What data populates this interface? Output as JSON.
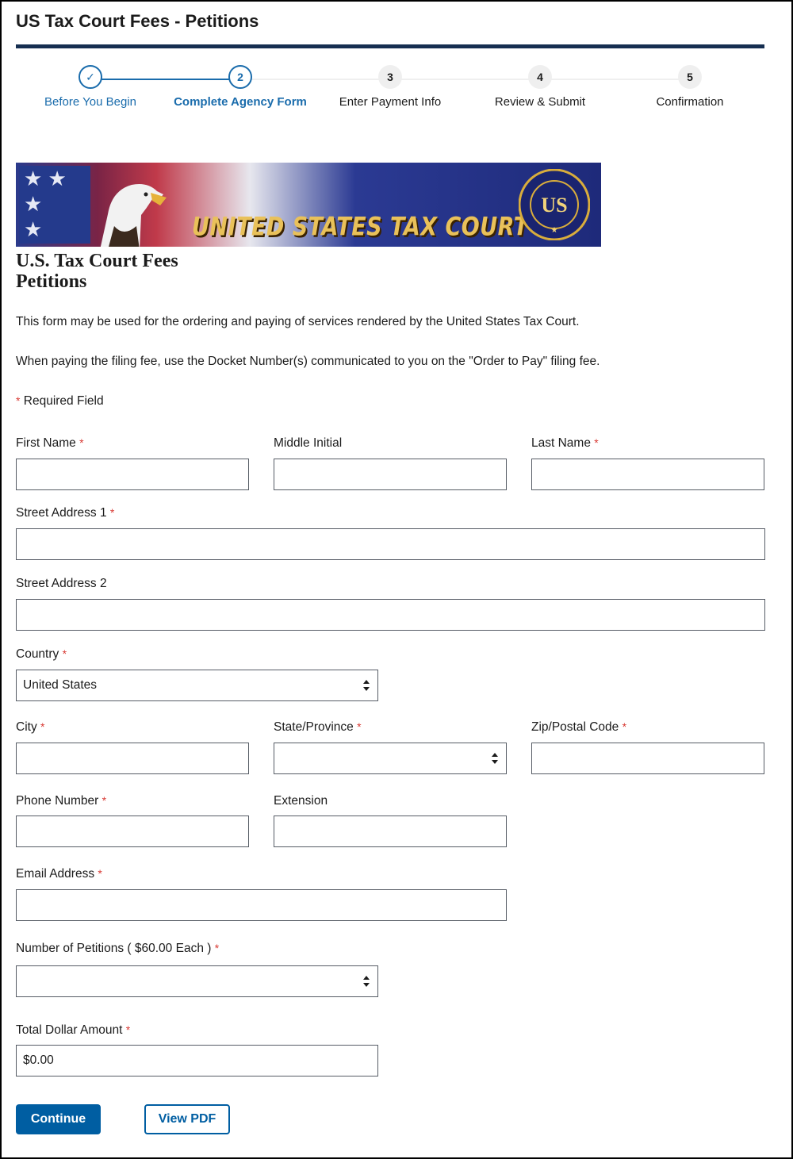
{
  "app": {
    "title": "US Tax Court Fees - Petitions"
  },
  "stepper": {
    "steps": [
      {
        "number": "✓",
        "label": "Before You Begin",
        "state": "done"
      },
      {
        "number": "2",
        "label": "Complete Agency Form",
        "state": "current"
      },
      {
        "number": "3",
        "label": "Enter Payment Info",
        "state": "future"
      },
      {
        "number": "4",
        "label": "Review & Submit",
        "state": "future"
      },
      {
        "number": "5",
        "label": "Confirmation",
        "state": "future"
      }
    ]
  },
  "banner": {
    "text": "UNITED STATES TAX COURT",
    "seal_text": "UNITED STATES TAX COURT",
    "seal_initials": "US"
  },
  "form": {
    "title_line1": "U.S. Tax Court Fees",
    "title_line2": "Petitions",
    "intro1": "This form may be used for the ordering and paying of services rendered by the United States Tax Court.",
    "intro2": "When paying the filing fee, use the Docket Number(s) communicated to you on the \"Order to Pay\" filing fee.",
    "required_note": "Required Field",
    "required_marker": "*",
    "fields": {
      "first_name": {
        "label": "First Name",
        "value": ""
      },
      "middle_initial": {
        "label": "Middle Initial",
        "value": ""
      },
      "last_name": {
        "label": "Last Name",
        "value": ""
      },
      "street1": {
        "label": "Street Address 1",
        "value": ""
      },
      "street2": {
        "label": "Street Address 2",
        "value": ""
      },
      "country": {
        "label": "Country",
        "value": "United States"
      },
      "city": {
        "label": "City",
        "value": ""
      },
      "state": {
        "label": "State/Province",
        "value": ""
      },
      "zip": {
        "label": "Zip/Postal Code",
        "value": ""
      },
      "phone": {
        "label": "Phone Number",
        "value": ""
      },
      "extension": {
        "label": "Extension",
        "value": ""
      },
      "email": {
        "label": "Email Address",
        "value": ""
      },
      "petitions": {
        "label": "Number of Petitions ( $60.00 Each )",
        "value": ""
      },
      "total": {
        "label": "Total Dollar Amount",
        "value": "$0.00"
      }
    }
  },
  "buttons": {
    "continue": "Continue",
    "view_pdf": "View PDF"
  },
  "colors": {
    "primary": "#005ea2",
    "step_active": "#1a6cac",
    "required": "#d83933",
    "rule": "#162e51"
  }
}
